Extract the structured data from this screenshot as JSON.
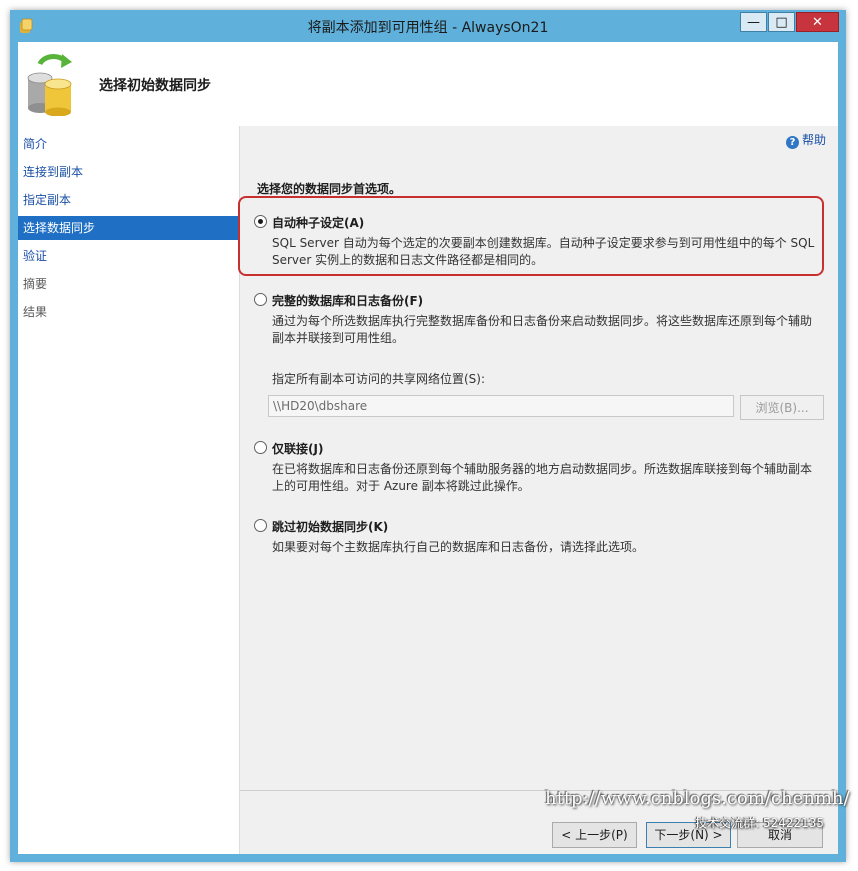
{
  "window": {
    "title": "将副本添加到可用性组 - AlwaysOn21",
    "minimize_label": "—",
    "maximize_label": "□",
    "close_label": "✕"
  },
  "header": {
    "title": "选择初始数据同步",
    "icon": "database-sync-icon"
  },
  "sidebar": {
    "items": [
      {
        "label": "简介",
        "state": "link"
      },
      {
        "label": "连接到副本",
        "state": "link"
      },
      {
        "label": "指定副本",
        "state": "link"
      },
      {
        "label": "选择数据同步",
        "state": "active"
      },
      {
        "label": "验证",
        "state": "link"
      },
      {
        "label": "摘要",
        "state": "disabled"
      },
      {
        "label": "结果",
        "state": "disabled"
      }
    ]
  },
  "main": {
    "help_label": "帮助",
    "prompt": "选择您的数据同步首选项。",
    "options": [
      {
        "label": "自动种子设定(A)",
        "selected": true,
        "desc_lines": [
          "SQL Server 自动为每个选定的次要副本创建数据库。自动种子设定要求参与到可用性组中的每个 SQL",
          "Server 实例上的数据和日志文件路径都是相同的。"
        ]
      },
      {
        "label": "完整的数据库和日志备份(F)",
        "selected": false,
        "desc_lines": [
          "通过为每个所选数据库执行完整数据库备份和日志备份来启动数据同步。将这些数据库还原到每个辅助",
          "副本并联接到可用性组。"
        ]
      },
      {
        "label": "仅联接(J)",
        "selected": false,
        "desc_lines": [
          "在已将数据库和日志备份还原到每个辅助服务器的地方启动数据同步。所选数据库联接到每个辅助副本",
          "上的可用性组。对于 Azure 副本将跳过此操作。"
        ]
      },
      {
        "label": "跳过初始数据同步(K)",
        "selected": false,
        "desc_lines": [
          "如果要对每个主数据库执行自己的数据库和日志备份，请选择此选项。"
        ]
      }
    ],
    "share_label": "指定所有副本可访问的共享网络位置(S):",
    "share_value": "\\\\HD20\\dbshare",
    "browse_label": "浏览(B)..."
  },
  "footer": {
    "prev_label": "< 上一步(P)",
    "next_label": "下一步(N) >",
    "cancel_label": "取消"
  },
  "watermark": {
    "url": "http://www.cnblogs.com/chenmh/",
    "group": "技术交流群: 52422135"
  },
  "colors": {
    "frame": "#5fb0da",
    "active_nav": "#1f6fc4",
    "link": "#1a4fa6",
    "highlight": "#c83030"
  }
}
